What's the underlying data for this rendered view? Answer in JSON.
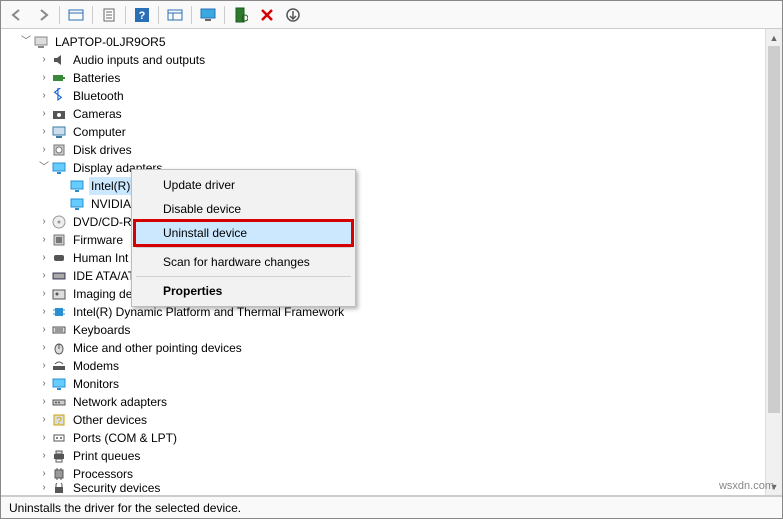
{
  "toolbar": {
    "back": "back",
    "forward": "forward",
    "show_hidden": "show-hidden",
    "properties": "properties",
    "help": "help",
    "views": "views",
    "monitor": "monitor",
    "scan": "scan",
    "remove": "remove",
    "update": "update"
  },
  "root": {
    "label": "LAPTOP-0LJR9OR5"
  },
  "categories": [
    {
      "label": "Audio inputs and outputs",
      "icon": "audio"
    },
    {
      "label": "Batteries",
      "icon": "battery"
    },
    {
      "label": "Bluetooth",
      "icon": "bluetooth"
    },
    {
      "label": "Cameras",
      "icon": "camera"
    },
    {
      "label": "Computer",
      "icon": "computer"
    },
    {
      "label": "Disk drives",
      "icon": "disk"
    },
    {
      "label": "Display adapters",
      "icon": "display",
      "expanded": true,
      "children": [
        {
          "label": "Intel(R)",
          "icon": "display",
          "selected": true
        },
        {
          "label": "NVIDIA",
          "icon": "display"
        }
      ]
    },
    {
      "label": "DVD/CD-R",
      "icon": "dvd",
      "truncated": true
    },
    {
      "label": "Firmware",
      "icon": "firmware"
    },
    {
      "label": "Human Int",
      "icon": "hid",
      "truncated": true
    },
    {
      "label": "IDE ATA/AT",
      "icon": "ide",
      "truncated": true
    },
    {
      "label": "Imaging de",
      "icon": "imaging",
      "truncated": true
    },
    {
      "label": "Intel(R) Dynamic Platform and Thermal Framework",
      "icon": "chip"
    },
    {
      "label": "Keyboards",
      "icon": "keyboard"
    },
    {
      "label": "Mice and other pointing devices",
      "icon": "mouse"
    },
    {
      "label": "Modems",
      "icon": "modem"
    },
    {
      "label": "Monitors",
      "icon": "monitor"
    },
    {
      "label": "Network adapters",
      "icon": "network"
    },
    {
      "label": "Other devices",
      "icon": "other"
    },
    {
      "label": "Ports (COM & LPT)",
      "icon": "port"
    },
    {
      "label": "Print queues",
      "icon": "printer"
    },
    {
      "label": "Processors",
      "icon": "cpu"
    },
    {
      "label": "Security devices",
      "icon": "security",
      "cut": true
    }
  ],
  "context_menu": {
    "items": [
      {
        "label": "Update driver",
        "type": "item"
      },
      {
        "label": "Disable device",
        "type": "item"
      },
      {
        "label": "Uninstall device",
        "type": "item",
        "highlighted": true
      },
      {
        "type": "sep"
      },
      {
        "label": "Scan for hardware changes",
        "type": "item"
      },
      {
        "type": "sep"
      },
      {
        "label": "Properties",
        "type": "item",
        "bold": true
      }
    ]
  },
  "status": {
    "text": "Uninstalls the driver for the selected device."
  },
  "watermark": "wsxdn.com"
}
